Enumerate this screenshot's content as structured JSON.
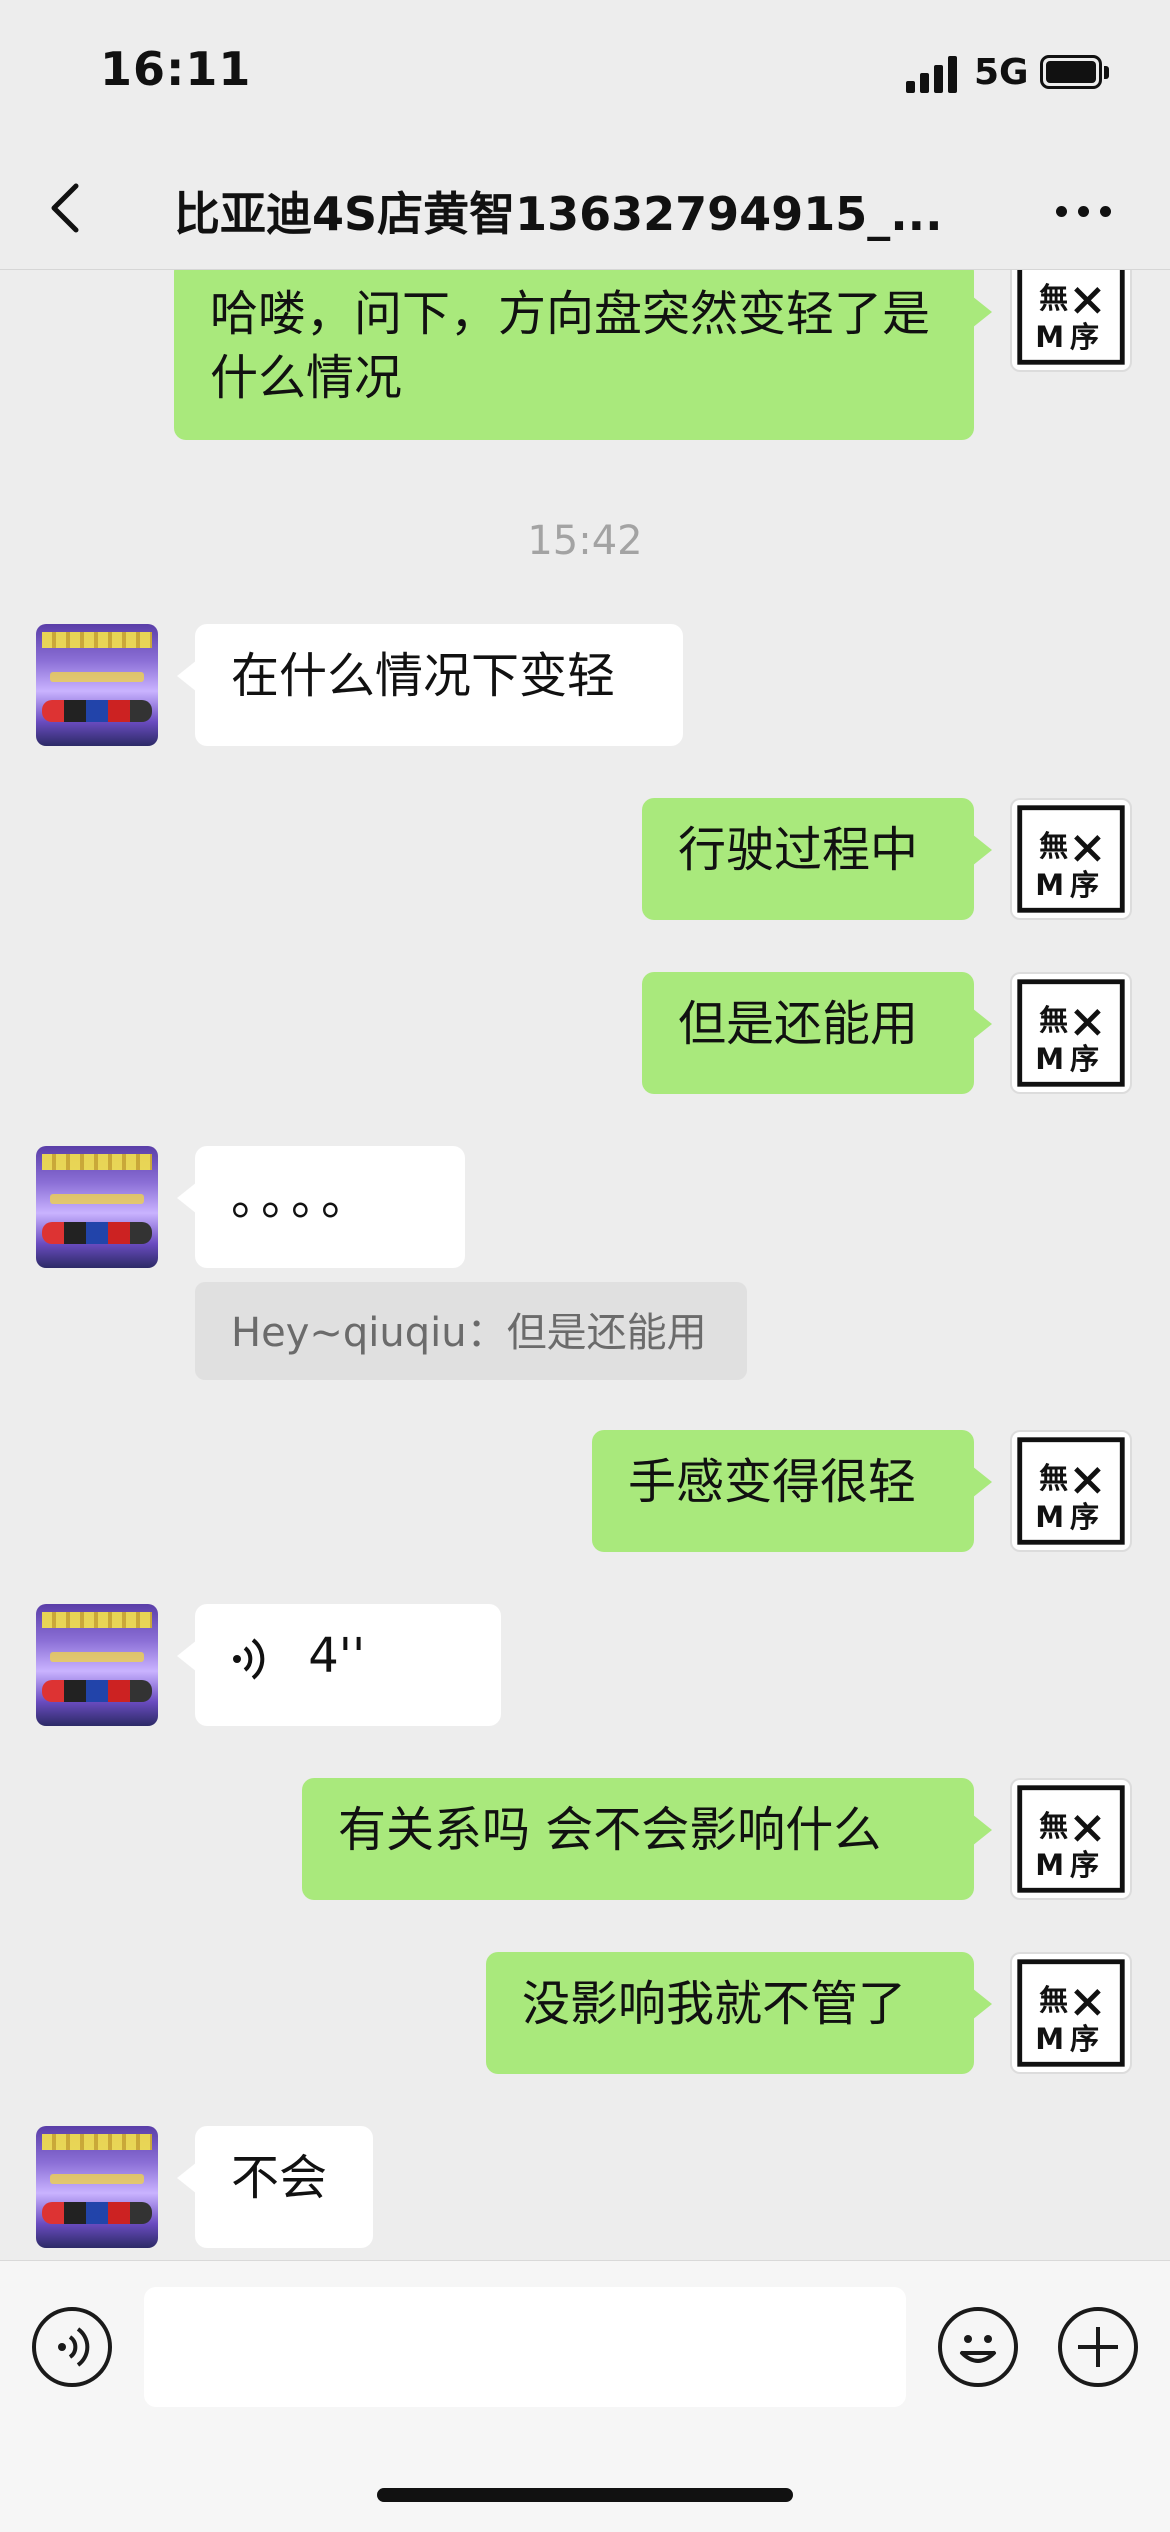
{
  "status_bar": {
    "time": "16:11",
    "network": "5G"
  },
  "header": {
    "title": "比亚迪4S店黄智13632794915_..."
  },
  "chat": {
    "timestamp": "15:42",
    "m1": "哈喽，问下，方向盘突然变轻了是什么情况",
    "m2": "在什么情况下变轻",
    "m3": "行驶过程中",
    "m4": "但是还能用",
    "m5": "。。。。",
    "m5_quote": "Hey~qiuqiu：但是还能用",
    "m6": "手感变得很轻",
    "m7_duration": "4''",
    "m8": "有关系吗 会不会影响什么",
    "m9": "没影响我就不管了",
    "m10": "不会"
  },
  "input": {
    "placeholder": ""
  },
  "colors": {
    "self_bubble": "#a9e97c",
    "other_bubble": "#ffffff",
    "background": "#ededed"
  }
}
